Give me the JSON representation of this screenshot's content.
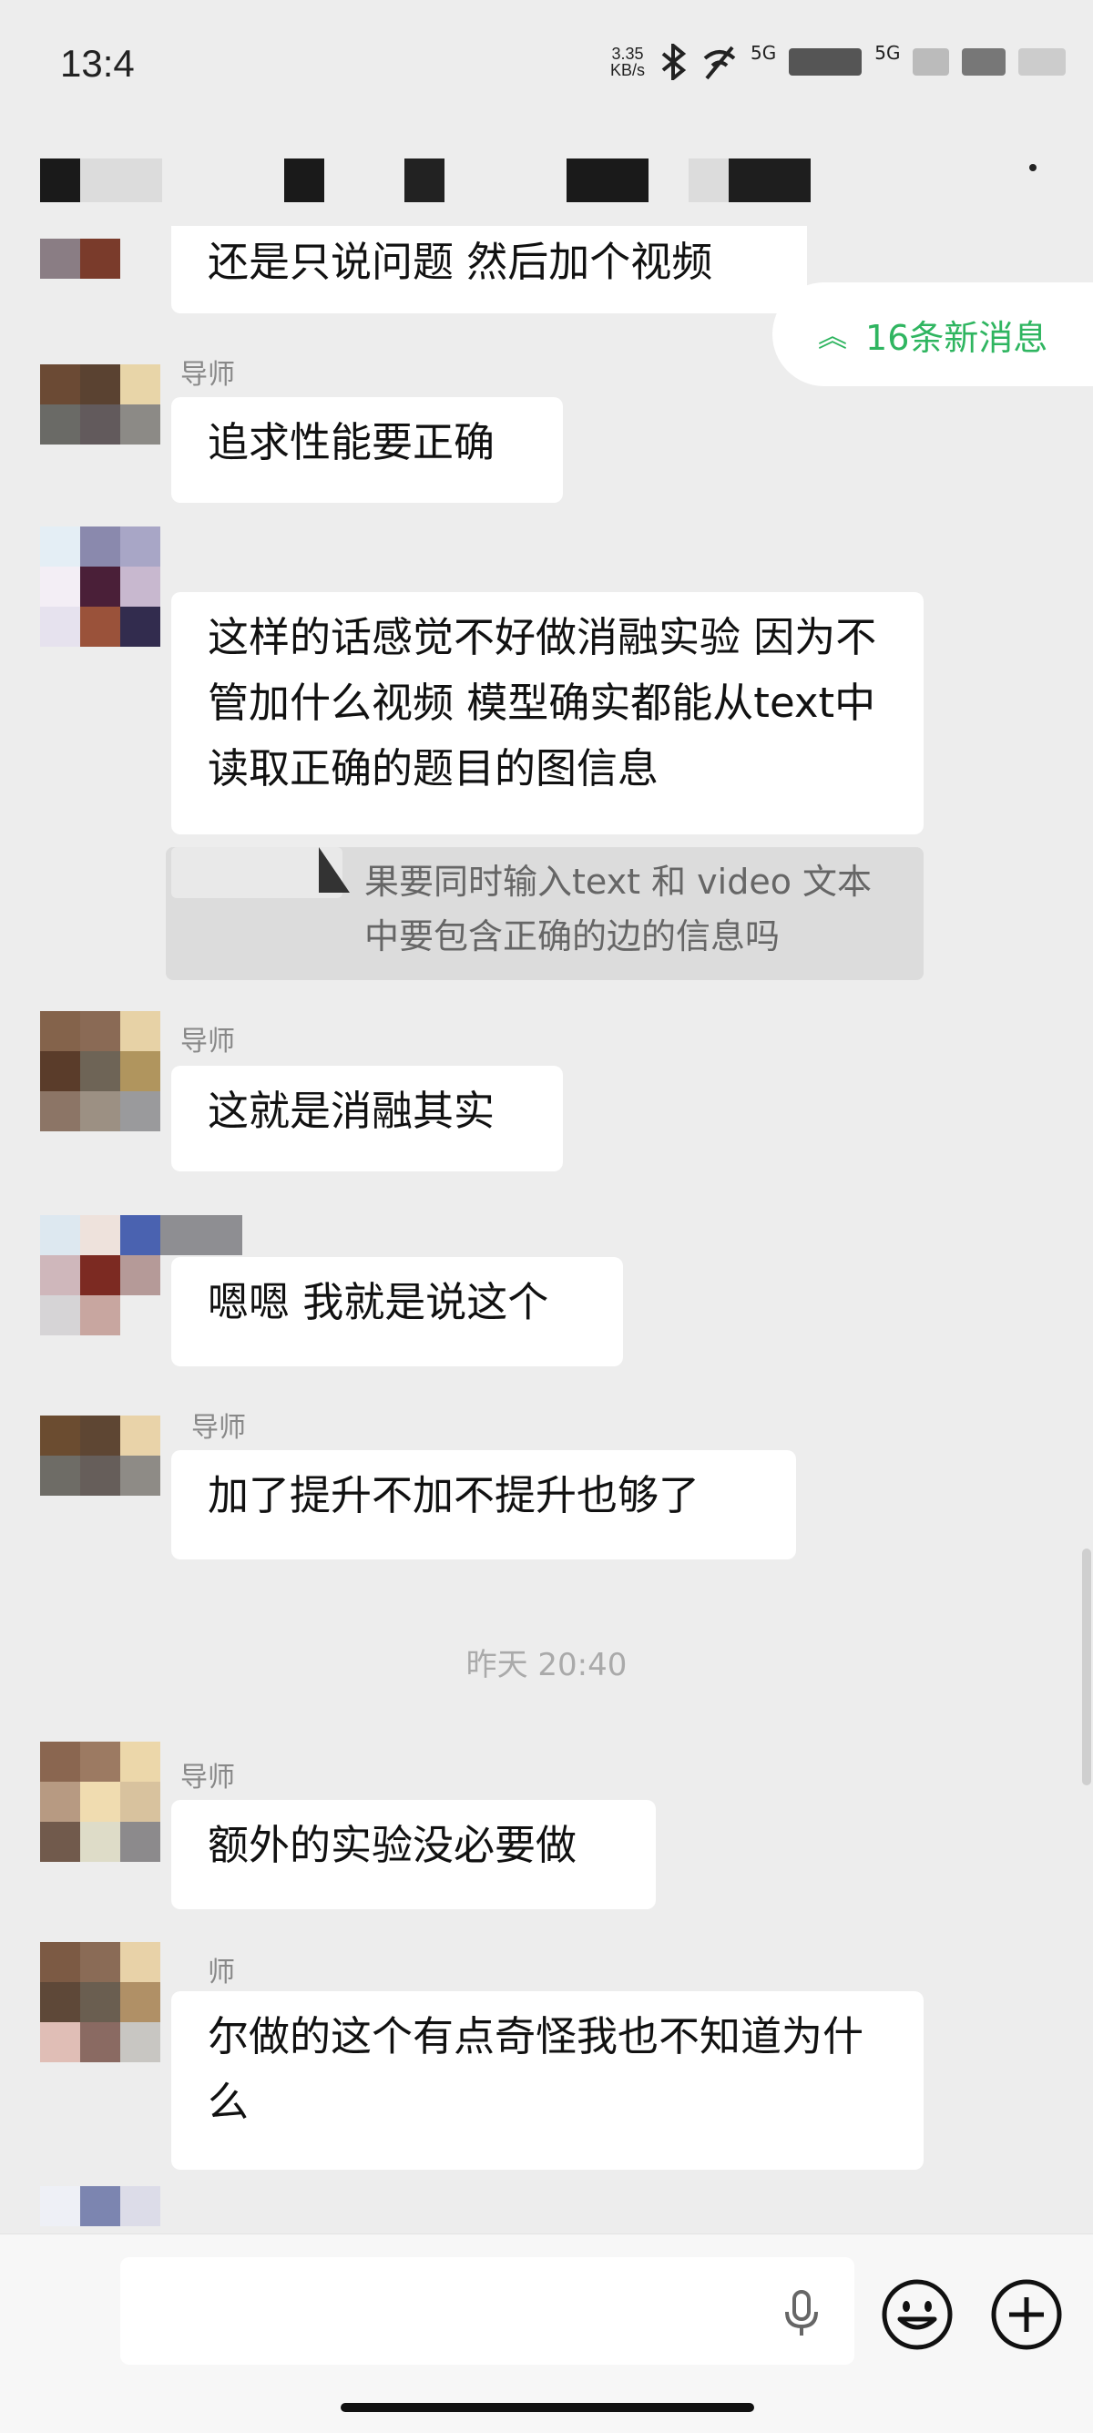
{
  "status_bar": {
    "time": "13:4",
    "net_speed_value": "3.35",
    "net_speed_unit": "KB/s",
    "signal_1": "5G",
    "signal_2": "5G"
  },
  "new_messages": {
    "label": "16条新消息"
  },
  "messages": [
    {
      "text": "还是只说问题 然后加个视频"
    },
    {
      "sender": "导师",
      "text": "追求性能要正确"
    },
    {
      "text": "这样的话感觉不好做消融实验 因为不管加什么视频 模型确实都能从text中读取正确的题目的图信息"
    },
    {
      "quote": "果要同时输入text 和 video 文本中要包含正确的边的信息吗"
    },
    {
      "sender": "导师",
      "text": "这就是消融其实"
    },
    {
      "text": "嗯嗯 我就是说这个"
    },
    {
      "sender": "导师",
      "text": "加了提升不加不提升也够了"
    },
    {
      "sender": "导师",
      "text": "额外的实验没必要做"
    },
    {
      "sender": "师",
      "text": "尔做的这个有点奇怪我也不知道为什么"
    }
  ],
  "timestamp": "昨天 20:40",
  "colors": {
    "background": "#ededed",
    "bubble": "#ffffff",
    "accent_green": "#2fb560"
  },
  "icons": [
    "voice-input-icon",
    "emoji-icon",
    "more-functions-icon",
    "chevron-double-up-icon",
    "bluetooth-icon"
  ]
}
